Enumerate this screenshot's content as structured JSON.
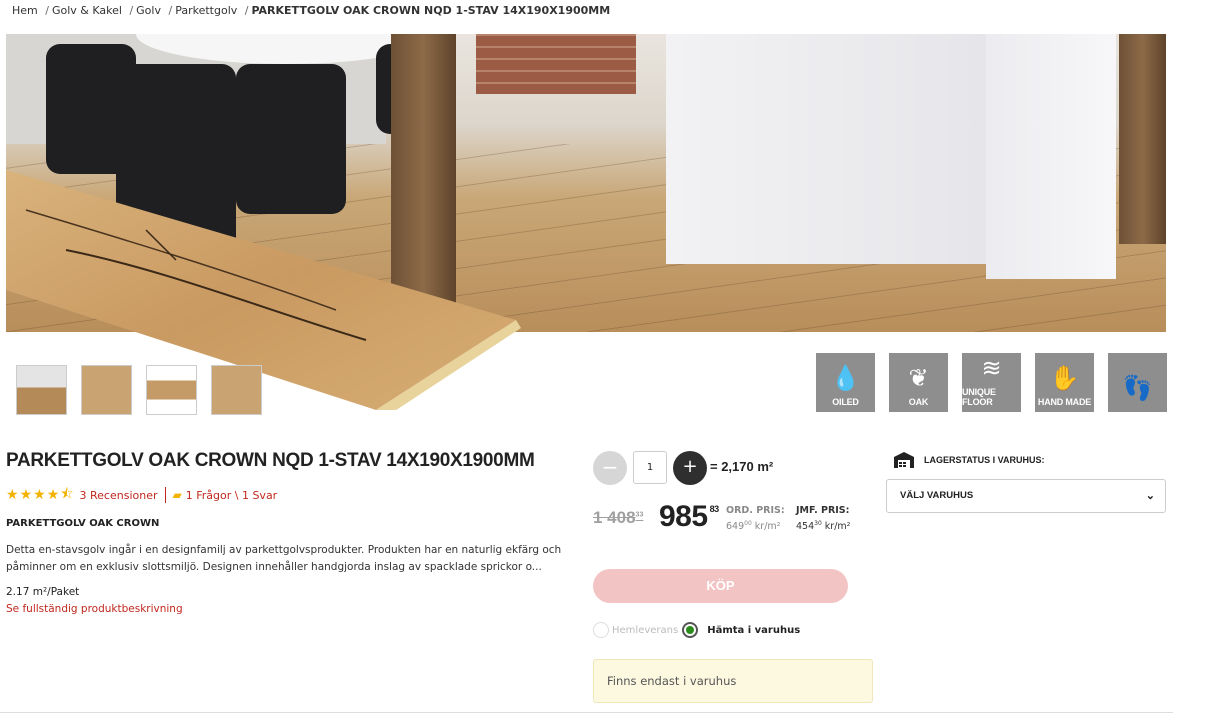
{
  "breadcrumb": {
    "items": [
      "Hem",
      "Golv & Kakel",
      "Golv",
      "Parkettgolv"
    ],
    "current": "PARKETTGOLV OAK CROWN NQD 1-STAV 14X190X1900MM"
  },
  "features": [
    {
      "label": "OILED",
      "icon": "drop-icon"
    },
    {
      "label": "OAK",
      "icon": "oak-leaf-icon"
    },
    {
      "label": "UNIQUE FLOOR",
      "icon": "fingerprint-icon"
    },
    {
      "label": "HAND MADE",
      "icon": "hand-icon"
    },
    {
      "label": "",
      "icon": "footprint-smile-icon"
    }
  ],
  "product": {
    "title": "PARKETTGOLV OAK CROWN NQD 1-STAV 14X190X1900MM",
    "rating": 4.5,
    "reviews": "3 Recensioner",
    "qa": "1 Frågor \\ 1 Svar",
    "subhead": "PARKETTGOLV OAK CROWN",
    "description": "Detta en-stavsgolv ingår i en designfamilj av parkettgolvsprodukter. Produkten har en naturlig ekfärg och påminner om en exklusiv slottsmiljö. Designen innehåller handgjorda inslag av spacklade sprickor o...",
    "unit": "2.17 m²/Paket",
    "full_description_link": "Se fullständig produktbeskrivning"
  },
  "purchase": {
    "minus": "−",
    "quantity": "1",
    "plus": "+",
    "area": "= 2,170 m²",
    "old_price_main": "1 408",
    "old_price_dec": "33",
    "new_price_main": "985",
    "new_price_dec": "83",
    "ord_label": "ORD. PRIS:",
    "ord_value": "649",
    "ord_value_dec": "00",
    "ord_unit": " kr/m²",
    "jmf_label": "JMF. PRIS:",
    "jmf_value": "454",
    "jmf_value_dec": "30",
    "jmf_unit": " kr/m²",
    "buy_label": "KÖP",
    "delivery_home": "Hemleverans",
    "delivery_store": "Hämta i varuhus",
    "notice": "Finns endast i varuhus"
  },
  "stock": {
    "heading": "LAGERSTATUS I VARUHUS:",
    "select_label": "VÄLJ VARUHUS"
  },
  "colors": {
    "accent_red": "#c0281e",
    "buy_disabled": "#f3c4c4",
    "star": "#f2b300",
    "radio_selected": "#2a8a1a"
  }
}
